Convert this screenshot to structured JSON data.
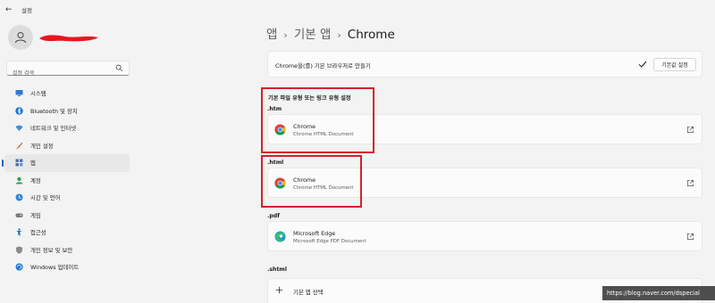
{
  "window": {
    "title": "설정",
    "back_glyph": "←"
  },
  "search": {
    "placeholder": "설정 검색"
  },
  "sidebar": {
    "items": [
      {
        "label": "시스템",
        "icon": "monitor-icon"
      },
      {
        "label": "Bluetooth 및 장치",
        "icon": "bluetooth-icon"
      },
      {
        "label": "네트워크 및 인터넷",
        "icon": "wifi-icon"
      },
      {
        "label": "개인 설정",
        "icon": "brush-icon"
      },
      {
        "label": "앱",
        "icon": "apps-icon",
        "active": true
      },
      {
        "label": "계정",
        "icon": "account-icon"
      },
      {
        "label": "시간 및 언어",
        "icon": "globe-clock-icon"
      },
      {
        "label": "게임",
        "icon": "gamepad-icon"
      },
      {
        "label": "접근성",
        "icon": "accessibility-icon"
      },
      {
        "label": "개인 정보 및 보안",
        "icon": "shield-icon"
      },
      {
        "label": "Windows 업데이트",
        "icon": "update-icon"
      }
    ]
  },
  "breadcrumb": {
    "level1": "앱",
    "level2": "기본 앱",
    "current": "Chrome",
    "separator": "›"
  },
  "default_row": {
    "text": "Chrome을(를) 기본 브라우저로 만들기",
    "button": "기본값 설정"
  },
  "section_heading": "기본 파일 유형 또는 링크 유형 설정",
  "associations": [
    {
      "ext": ".htm",
      "app": "Chrome",
      "desc": "Chrome HTML Document",
      "icon": "chrome-icon"
    },
    {
      "ext": ".html",
      "app": "Chrome",
      "desc": "Chrome HTML Document",
      "icon": "chrome-icon"
    },
    {
      "ext": ".pdf",
      "app": "Microsoft Edge",
      "desc": "Microsoft Edge PDF Document",
      "icon": "edge-icon"
    }
  ],
  "shtml": {
    "ext": ".shtml",
    "choose": "기본 앱 선택"
  },
  "watermark": "https://blog.naver.com/dspecial",
  "colors": {
    "accent": "#0067c0",
    "highlight": "#d2222d",
    "background": "#f3f3f3",
    "card": "#fbfbfb"
  }
}
